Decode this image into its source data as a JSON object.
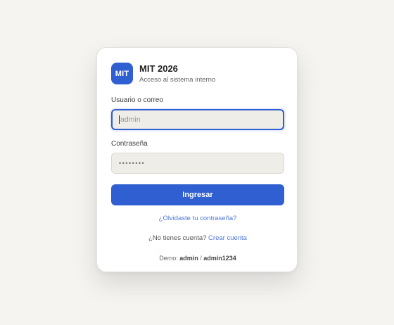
{
  "app": {
    "logo_text": "MIT",
    "title": "MIT 2026",
    "subtitle": "Acceso al sistema interno"
  },
  "form": {
    "username": {
      "label": "Usuario o correo",
      "placeholder": "admin",
      "value": ""
    },
    "password": {
      "label": "Contraseña",
      "masked_value": "••••••••"
    },
    "submit_label": "Ingresar"
  },
  "links": {
    "forgot_password": "¿Olvidaste tu contraseña?",
    "no_account_text": "¿No tienes cuenta?",
    "create_account": "Crear cuenta"
  },
  "demo": {
    "prefix": "Demo:",
    "user": "admin",
    "separator": "/",
    "password": "admin1234"
  },
  "colors": {
    "accent": "#2f5fd0",
    "link": "#4f78d8",
    "background": "#f5f4f1",
    "card": "#ffffff",
    "field": "#efede8"
  }
}
